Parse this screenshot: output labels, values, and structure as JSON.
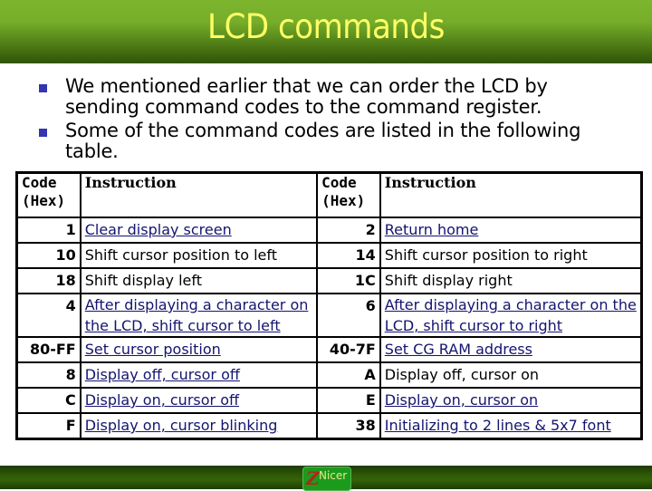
{
  "header": {
    "title": "LCD commands"
  },
  "bullets": [
    {
      "icon": "square-bullet-icon",
      "text_lines": [
        "We mentioned earlier that we can order the LCD by",
        "sending command codes to the command register."
      ]
    },
    {
      "icon": "square-bullet-icon",
      "text_lines": [
        "Some of the command codes are listed in the following",
        "table."
      ]
    }
  ],
  "table": {
    "headers": {
      "code_line1": "Code",
      "code_line2": "(Hex)",
      "instruction": "Instruction"
    },
    "rows": [
      {
        "left_code": "1",
        "left_inst": [
          "Clear display screen"
        ],
        "left_link": true,
        "right_code": "2",
        "right_inst": [
          "Return home"
        ],
        "right_link": true
      },
      {
        "left_code": "10",
        "left_inst": [
          "Shift cursor position to left"
        ],
        "left_link": false,
        "right_code": "14",
        "right_inst": [
          "Shift cursor position to right"
        ],
        "right_link": false
      },
      {
        "left_code": "18",
        "left_inst": [
          "Shift display left"
        ],
        "left_link": false,
        "right_code": "1C",
        "right_inst": [
          "Shift display right"
        ],
        "right_link": false
      },
      {
        "left_code": "4",
        "left_inst": [
          "After displaying a character on",
          "the LCD, shift cursor to left"
        ],
        "left_link": true,
        "right_code": "6",
        "right_inst": [
          "After displaying a character on the",
          "LCD, shift cursor to right"
        ],
        "right_link": true
      },
      {
        "left_code": "80-FF",
        "left_inst": [
          "Set cursor position"
        ],
        "left_link": true,
        "right_code": "40-7F",
        "right_inst": [
          "Set CG RAM address"
        ],
        "right_link": true
      },
      {
        "left_code": "8",
        "left_inst": [
          "Display off, cursor off"
        ],
        "left_link": true,
        "right_code": "A",
        "right_inst": [
          "Display off, cursor on"
        ],
        "right_link": false
      },
      {
        "left_code": "C",
        "left_inst": [
          "Display on, cursor off"
        ],
        "left_link": true,
        "right_code": "E",
        "right_inst": [
          "Display on, cursor on"
        ],
        "right_link": true
      },
      {
        "left_code": "F",
        "left_inst": [
          "Display on, cursor blinking"
        ],
        "left_link": true,
        "right_code": "38",
        "right_inst": [
          "Initializing to 2 lines & 5x7 font"
        ],
        "right_link": true
      }
    ]
  },
  "footer": {
    "logo_text": "Nicer",
    "logo_mark": "Z",
    "logo_icon": "nicer-logo-icon"
  },
  "colors": {
    "title_text": "#ffff66",
    "title_bar": "#76ad2a",
    "bullet": "#3535b0",
    "link": "#141470",
    "footer": "#2e5a06"
  }
}
